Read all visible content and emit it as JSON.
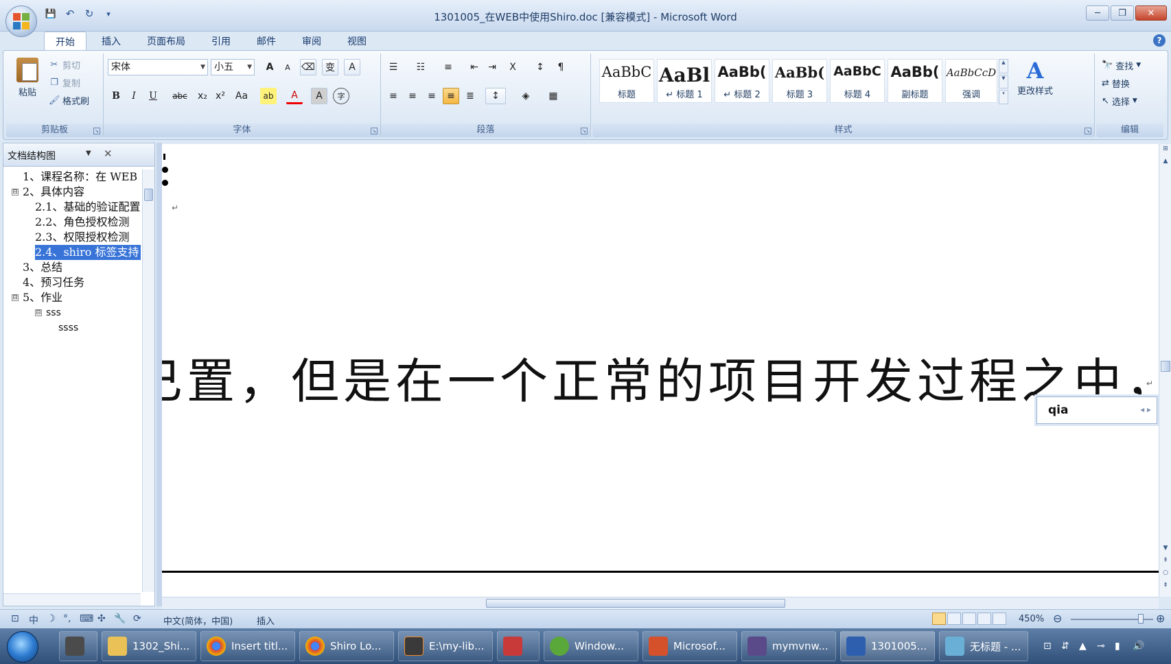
{
  "window": {
    "title": "1301005_在WEB中使用Shiro.doc [兼容模式] - Microsoft Word",
    "minimize": "─",
    "restore": "❐",
    "close": "✕"
  },
  "qat": {
    "save": "💾",
    "undo": "↶",
    "redo": "↻",
    "more": "▾"
  },
  "ribbon": {
    "tabs": [
      "开始",
      "插入",
      "页面布局",
      "引用",
      "邮件",
      "审阅",
      "视图"
    ],
    "active_tab": 0,
    "clipboard": {
      "label": "剪贴板",
      "paste": "粘贴",
      "cut": "剪切",
      "copy": "复制",
      "format_painter": "格式刷"
    },
    "font": {
      "label": "字体",
      "font_name": "宋体",
      "font_size": "小五",
      "grow": "A",
      "shrink": "A",
      "clear": "⌫",
      "phonetic": "变",
      "border": "A",
      "bold": "B",
      "italic": "I",
      "underline": "U",
      "strike": "abc",
      "subscript": "x₂",
      "superscript": "x²",
      "case": "Aa",
      "highlight": "ab",
      "font_color": "A",
      "shade": "A",
      "enclose": "字"
    },
    "paragraph": {
      "label": "段落",
      "bullets": "☰",
      "numbering": "☷",
      "multilevel": "≡",
      "decrease_indent": "⇤",
      "increase_indent": "⇥",
      "chinese_layout": "X",
      "sort": "↕",
      "show_marks": "¶",
      "align_left": "≡",
      "center": "≡",
      "align_right": "≡",
      "justify": "≡",
      "distributed": "≣",
      "line_spacing": "↕",
      "shading": "◈",
      "borders": "▦"
    },
    "styles": {
      "label": "样式",
      "items": [
        {
          "sample": "AaBbC",
          "name": "标题"
        },
        {
          "sample": "AaBl",
          "name": "↵ 标题 1"
        },
        {
          "sample": "AaBb(",
          "name": "↵ 标题 2"
        },
        {
          "sample": "AaBb(",
          "name": "标题 3"
        },
        {
          "sample": "AaBbC",
          "name": "标题 4"
        },
        {
          "sample": "AaBb(",
          "name": "副标题"
        },
        {
          "sample": "AaBbCcD",
          "name": "强调"
        }
      ],
      "change_styles": "更改样式",
      "change_styles_icon": "A"
    },
    "editing": {
      "label": "编辑",
      "find": "查找",
      "replace": "替换",
      "select": "选择"
    }
  },
  "docmap": {
    "title": "文档结构图",
    "close": "✕",
    "items": [
      {
        "text": "1、课程名称：在 WEB",
        "level": 0,
        "toggle": ""
      },
      {
        "text": "2、具体内容",
        "level": 0,
        "toggle": "⊟"
      },
      {
        "text": "2.1、基础的验证配置",
        "level": 1,
        "toggle": ""
      },
      {
        "text": "2.2、角色授权检测",
        "level": 1,
        "toggle": ""
      },
      {
        "text": "2.3、权限授权检测",
        "level": 1,
        "toggle": ""
      },
      {
        "text": "2.4、shiro 标签支持",
        "level": 1,
        "toggle": "",
        "selected": true
      },
      {
        "text": "3、总结",
        "level": 0,
        "toggle": ""
      },
      {
        "text": "4、预习任务",
        "level": 0,
        "toggle": ""
      },
      {
        "text": "5、作业",
        "level": 0,
        "toggle": "⊟"
      },
      {
        "text": "sss",
        "level": 2,
        "toggle": "⊟"
      },
      {
        "text": "ssss",
        "level": 3,
        "toggle": ""
      }
    ]
  },
  "document": {
    "body_text": "已置，但是在一个正常的项目开发过程之中，对于",
    "para_mark": "↵"
  },
  "ime": {
    "composition": "qia",
    "arrows": "◂ ▸"
  },
  "statusbar": {
    "language": "中文(简体，中国)",
    "mode": "插入",
    "zoom": "450%",
    "zoom_out": "⊖",
    "zoom_in": "⊕"
  },
  "taskbar": {
    "items": [
      {
        "label": "",
        "color": "#4b4b4b"
      },
      {
        "label": "1302_Shi...",
        "color": "#e9c157"
      },
      {
        "label": "Insert titl...",
        "color": "#d9442f"
      },
      {
        "label": "Shiro Lo...",
        "color": "#d9442f"
      },
      {
        "label": "E:\\my-lib...",
        "color": "#3a3a3a"
      },
      {
        "label": "",
        "color": "#c83a3a"
      },
      {
        "label": "Window...",
        "color": "#5ba83a"
      },
      {
        "label": "Microsof...",
        "color": "#d5512b"
      },
      {
        "label": "mymvnw...",
        "color": "#5a4a8a"
      },
      {
        "label": "1301005...",
        "color": "#2d5fae"
      },
      {
        "label": "无标题 - ...",
        "color": "#6ab0d6"
      }
    ]
  },
  "colors": {
    "accent": "#3874d8",
    "ribbon_bg": "#dde8f5",
    "taskbar": "#2f4f78"
  }
}
